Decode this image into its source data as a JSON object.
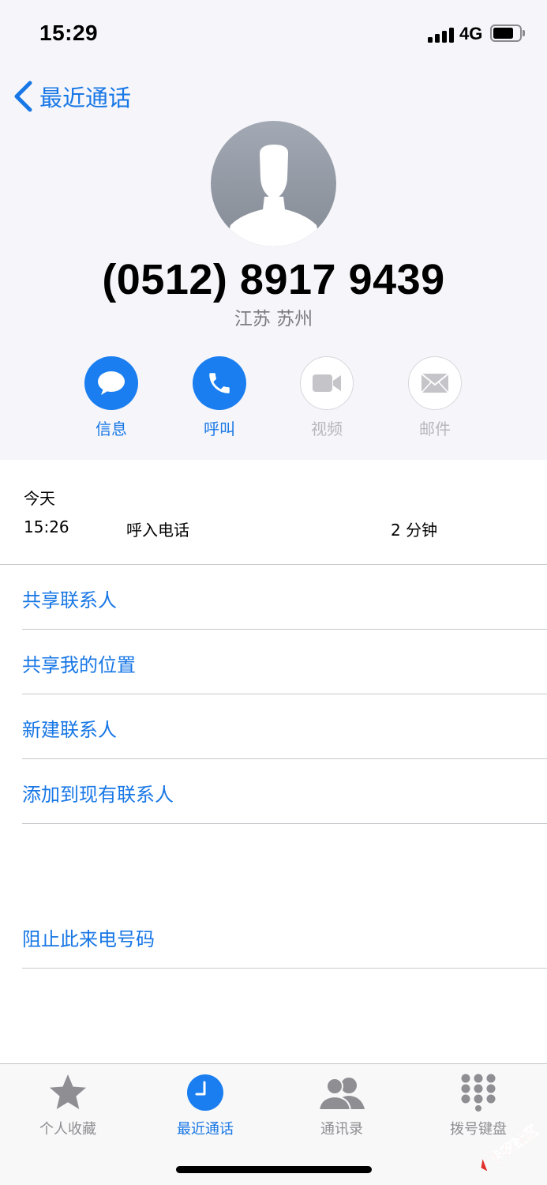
{
  "status_bar": {
    "time": "15:29",
    "network": "4G",
    "signal_bars": 4,
    "battery_level_fraction": 0.7
  },
  "nav": {
    "back_label": "最近通话"
  },
  "contact": {
    "phone_number": "(0512) 8917 9439",
    "location": "江苏 苏州"
  },
  "actions": [
    {
      "label": "信息",
      "icon": "message-bubble-icon",
      "enabled": true
    },
    {
      "label": "呼叫",
      "icon": "phone-icon",
      "enabled": true
    },
    {
      "label": "视频",
      "icon": "video-camera-icon",
      "enabled": false
    },
    {
      "label": "邮件",
      "icon": "mail-envelope-icon",
      "enabled": false
    }
  ],
  "call_log": {
    "date": "今天",
    "entries": [
      {
        "time": "15:26",
        "type": "呼入电话",
        "duration": "2 分钟"
      }
    ]
  },
  "options": {
    "share_contact": "共享联系人",
    "share_location": "共享我的位置",
    "new_contact": "新建联系人",
    "add_to_existing": "添加到现有联系人",
    "block_caller": "阻止此来电号码"
  },
  "tab_bar": {
    "tabs": [
      {
        "label": "个人收藏",
        "icon": "star-icon",
        "selected": false
      },
      {
        "label": "最近通话",
        "icon": "clock-icon",
        "selected": true
      },
      {
        "label": "通讯录",
        "icon": "contacts-icon",
        "selected": false
      },
      {
        "label": "拨号键盘",
        "icon": "keypad-icon",
        "selected": false
      }
    ]
  },
  "watermark": {
    "text": "卡农社区"
  },
  "colors": {
    "accent": "#1877e6",
    "button_blue": "#1a7ef0",
    "secondary_text": "#7c7c80",
    "disabled": "#b7b7bc",
    "header_background": "#f6f6fa"
  }
}
